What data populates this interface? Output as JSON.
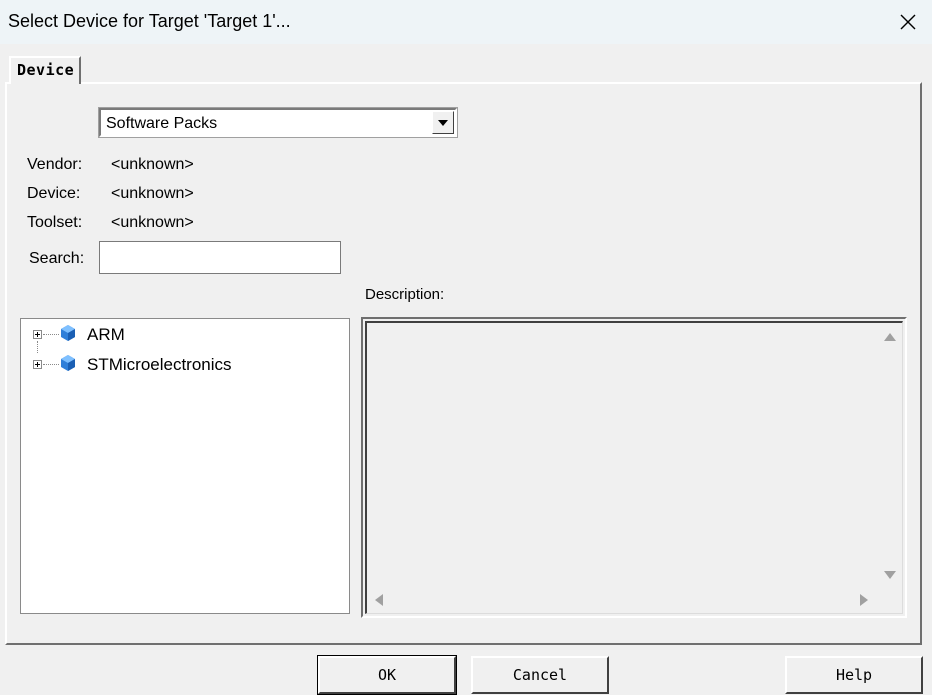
{
  "window": {
    "title": "Select Device for Target 'Target 1'...",
    "close_icon": "close-icon"
  },
  "tabs": [
    {
      "label": "Device",
      "selected": true
    }
  ],
  "source_select": {
    "value": "Software Packs",
    "arrow_icon": "chevron-down-icon"
  },
  "fields": {
    "vendor": {
      "label": "Vendor:",
      "value": "<unknown>"
    },
    "device": {
      "label": "Device:",
      "value": "<unknown>"
    },
    "toolset": {
      "label": "Toolset:",
      "value": "<unknown>"
    }
  },
  "search": {
    "label": "Search:",
    "value": ""
  },
  "description": {
    "label": "Description:",
    "text": ""
  },
  "tree": {
    "items": [
      {
        "label": "ARM",
        "icon": "vendor-gem-icon",
        "expanded": false
      },
      {
        "label": "STMicroelectronics",
        "icon": "vendor-gem-icon",
        "expanded": false
      }
    ]
  },
  "buttons": {
    "ok": "OK",
    "cancel": "Cancel",
    "help": "Help"
  },
  "colors": {
    "background": "#f0f0f0",
    "titlebar": "#eef4f7",
    "gem_blue": "#2f7fd9"
  }
}
